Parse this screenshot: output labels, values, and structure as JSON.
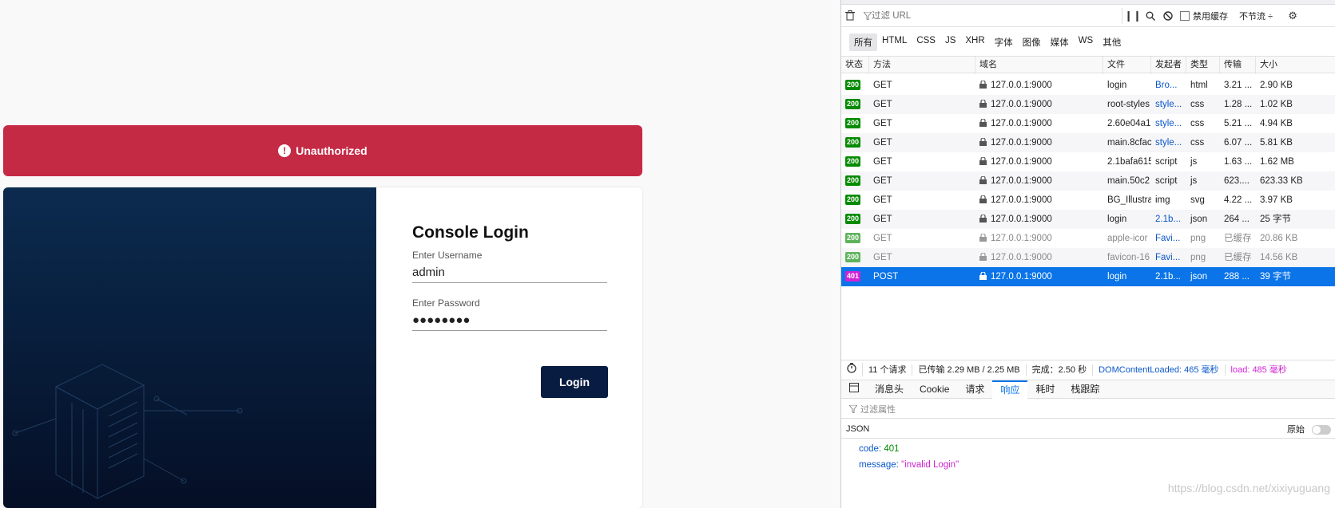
{
  "app": {
    "alert": {
      "icon": "exclamation-icon",
      "text": "Unauthorized",
      "color": "#c52a45"
    },
    "login": {
      "title": "Console Login",
      "username_label": "Enter Username",
      "username_value": "admin",
      "password_label": "Enter Password",
      "password_value": "●●●●●●●●",
      "button_label": "Login"
    }
  },
  "devtools": {
    "toolbar": {
      "filter_placeholder": "过滤 URL",
      "disable_cache_label": "禁用缓存",
      "throttle_label": "不节流 ÷"
    },
    "type_filters": [
      "所有",
      "HTML",
      "CSS",
      "JS",
      "XHR",
      "字体",
      "图像",
      "媒体",
      "WS",
      "其他"
    ],
    "columns": [
      "状态",
      "方法",
      "域名",
      "文件",
      "发起者",
      "类型",
      "传输",
      "大小"
    ],
    "requests": [
      {
        "status": "200",
        "method": "GET",
        "domain": "127.0.0.1:9000",
        "file": "login",
        "initiator": "Bro...",
        "type": "html",
        "transferred": "3.21 ...",
        "size": "2.90 KB",
        "state": "normal"
      },
      {
        "status": "200",
        "method": "GET",
        "domain": "127.0.0.1:9000",
        "file": "root-styles",
        "initiator": "style...",
        "type": "css",
        "transferred": "1.28 ...",
        "size": "1.02 KB",
        "state": "normal"
      },
      {
        "status": "200",
        "method": "GET",
        "domain": "127.0.0.1:9000",
        "file": "2.60e04a1",
        "initiator": "style...",
        "type": "css",
        "transferred": "5.21 ...",
        "size": "4.94 KB",
        "state": "normal"
      },
      {
        "status": "200",
        "method": "GET",
        "domain": "127.0.0.1:9000",
        "file": "main.8cfac",
        "initiator": "style...",
        "type": "css",
        "transferred": "6.07 ...",
        "size": "5.81 KB",
        "state": "normal"
      },
      {
        "status": "200",
        "method": "GET",
        "domain": "127.0.0.1:9000",
        "file": "2.1bafa615",
        "initiator": "script",
        "type": "js",
        "transferred": "1.63 ...",
        "size": "1.62 MB",
        "state": "normal"
      },
      {
        "status": "200",
        "method": "GET",
        "domain": "127.0.0.1:9000",
        "file": "main.50c2",
        "initiator": "script",
        "type": "js",
        "transferred": "623....",
        "size": "623.33 KB",
        "state": "normal"
      },
      {
        "status": "200",
        "method": "GET",
        "domain": "127.0.0.1:9000",
        "file": "BG_Illustra",
        "initiator": "img",
        "type": "svg",
        "transferred": "4.22 ...",
        "size": "3.97 KB",
        "state": "normal"
      },
      {
        "status": "200",
        "method": "GET",
        "domain": "127.0.0.1:9000",
        "file": "login",
        "initiator": "2.1b...",
        "type": "json",
        "transferred": "264 ...",
        "size": "25 字节",
        "state": "normal"
      },
      {
        "status": "200",
        "method": "GET",
        "domain": "127.0.0.1:9000",
        "file": "apple-icor",
        "initiator": "Favi...",
        "type": "png",
        "transferred": "已缓存",
        "size": "20.86 KB",
        "state": "cached"
      },
      {
        "status": "200",
        "method": "GET",
        "domain": "127.0.0.1:9000",
        "file": "favicon-16",
        "initiator": "Favi...",
        "type": "png",
        "transferred": "已缓存",
        "size": "14.56 KB",
        "state": "cached"
      },
      {
        "status": "401",
        "method": "POST",
        "domain": "127.0.0.1:9000",
        "file": "login",
        "initiator": "2.1b...",
        "type": "json",
        "transferred": "288 ...",
        "size": "39 字节",
        "state": "selected"
      }
    ],
    "summary": {
      "requests": "11 个请求",
      "transferred": "已传输 2.29 MB / 2.25 MB",
      "finish": "完成：2.50 秒",
      "dom_loaded": "DOMContentLoaded: 465 毫秒",
      "load": "load: 485 毫秒"
    },
    "detail_tabs": [
      "消息头",
      "Cookie",
      "请求",
      "响应",
      "耗时",
      "栈跟踪"
    ],
    "active_detail_tab": "响应",
    "prop_filter_placeholder": "过滤属性",
    "json_label": "JSON",
    "raw_label": "原始",
    "response": [
      {
        "key": "code:",
        "value": "401",
        "kind": "num"
      },
      {
        "key": "message:",
        "value": "\"invalid Login\"",
        "kind": "str"
      }
    ]
  },
  "watermark": "https://blog.csdn.net/xixiyuguang"
}
